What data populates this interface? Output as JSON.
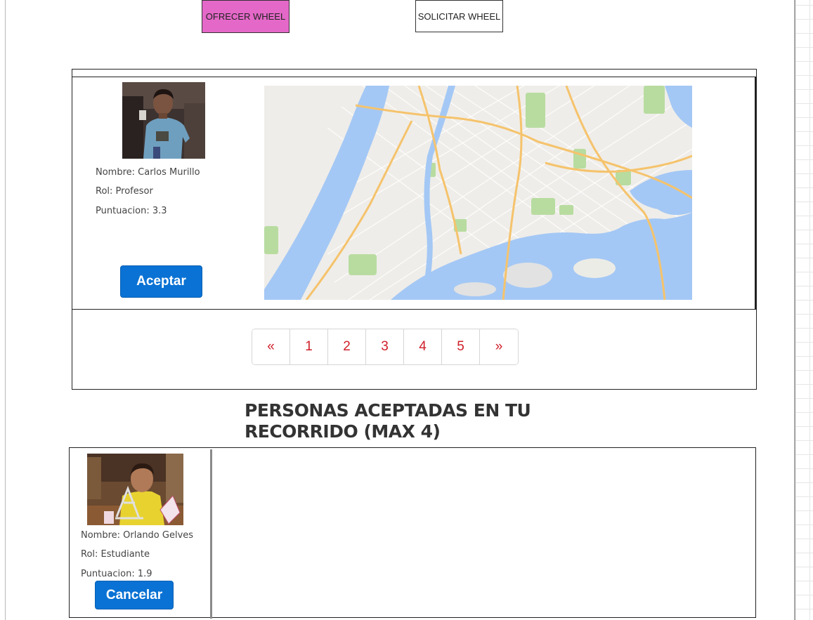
{
  "top_buttons": {
    "offer_label": "OFRECER WHEEL",
    "request_label": "SOLICITAR WHEEL",
    "offer_color": "#e468c8"
  },
  "offer": {
    "name": "Nombre: Carlos Murillo",
    "role": "Rol: Profesor",
    "score": "Puntuacion: 3.3",
    "accept_label": "Aceptar"
  },
  "pagination": {
    "prev": "«",
    "pages": [
      "1",
      "2",
      "3",
      "4",
      "5"
    ],
    "next": "»",
    "link_color": "#d01f2a"
  },
  "accepted": {
    "title": "PERSONAS ACEPTADAS EN TU RECORRIDO (MAX 4)",
    "person": {
      "name": "Nombre: Orlando Gelves",
      "role": "Rol: Estudiante",
      "score": "Puntuacion: 1.9",
      "cancel_label": "Cancelar"
    }
  },
  "colors": {
    "primary_button": "#0a72d4",
    "map_water": "#a4c8f5",
    "map_road": "#f5c36c",
    "map_park": "#b8dca0"
  }
}
